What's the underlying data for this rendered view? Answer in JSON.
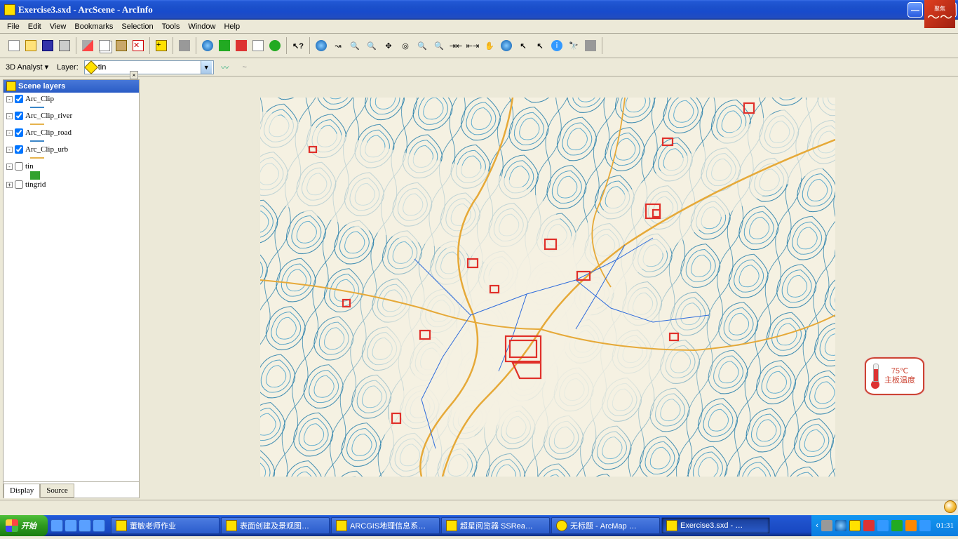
{
  "titlebar": {
    "title": "Exercise3.sxd - ArcScene - ArcInfo"
  },
  "menubar": [
    "File",
    "Edit",
    "View",
    "Bookmarks",
    "Selection",
    "Tools",
    "Window",
    "Help"
  ],
  "toolbar_3d": {
    "label": "3D Analyst ▾",
    "layer_label": "Layer:",
    "layer_value": "tin"
  },
  "toc": {
    "header": "Scene layers",
    "layers": [
      {
        "name": "Arc_Clip",
        "checked": true,
        "exp": "-",
        "swatch_type": "line",
        "swatch_color": "#3b86c8"
      },
      {
        "name": "Arc_Clip_river",
        "checked": true,
        "exp": "-",
        "swatch_type": "line",
        "swatch_color": "#e6b34c"
      },
      {
        "name": "Arc_Clip_road",
        "checked": true,
        "exp": "-",
        "swatch_type": "line",
        "swatch_color": "#3b86c8"
      },
      {
        "name": "Arc_Clip_urb",
        "checked": true,
        "exp": "-",
        "swatch_type": "line",
        "swatch_color": "#e6b34c"
      },
      {
        "name": "tin",
        "checked": false,
        "exp": "-",
        "swatch_type": "square",
        "swatch_color": "#32a22e"
      },
      {
        "name": "tingrid",
        "checked": false,
        "exp": "+",
        "swatch_type": "none"
      }
    ],
    "tabs": {
      "display": "Display",
      "source": "Source"
    }
  },
  "thermo": {
    "value": "75℃",
    "label": "主板温度"
  },
  "taskbar": {
    "start": "开始",
    "items": [
      {
        "label": "董敏老师作业",
        "icon": "folder"
      },
      {
        "label": "表面创建及景观图…",
        "icon": "doc"
      },
      {
        "label": "ARCGIS地理信息系…",
        "icon": "folder"
      },
      {
        "label": "超星阅览器 SSRea…",
        "icon": "red"
      },
      {
        "label": "无标题 - ArcMap …",
        "icon": "globe"
      },
      {
        "label": "Exercise3.sxd - …",
        "icon": "yellow",
        "active": true
      }
    ],
    "clock": "01:31"
  }
}
